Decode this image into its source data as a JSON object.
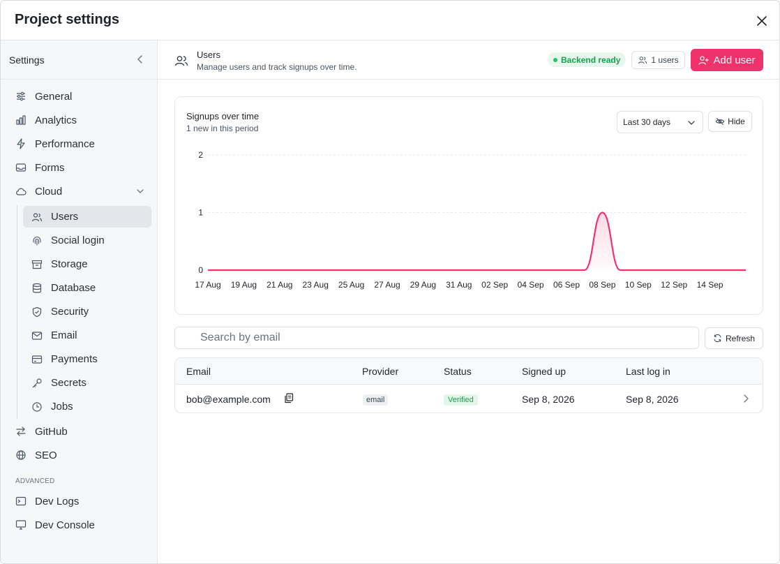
{
  "window": {
    "title": "Project settings"
  },
  "sidebar": {
    "header": "Settings",
    "items": [
      {
        "label": "General",
        "icon": "sliders-icon"
      },
      {
        "label": "Analytics",
        "icon": "bar-chart-icon"
      },
      {
        "label": "Performance",
        "icon": "lightning-icon"
      },
      {
        "label": "Forms",
        "icon": "inbox-icon"
      },
      {
        "label": "Cloud",
        "icon": "cloud-icon"
      }
    ],
    "cloud_items": [
      {
        "label": "Users",
        "icon": "users-icon"
      },
      {
        "label": "Social login",
        "icon": "fingerprint-icon"
      },
      {
        "label": "Storage",
        "icon": "archive-icon"
      },
      {
        "label": "Database",
        "icon": "database-icon"
      },
      {
        "label": "Security",
        "icon": "shield-icon"
      },
      {
        "label": "Email",
        "icon": "mail-icon"
      },
      {
        "label": "Payments",
        "icon": "credit-card-icon"
      },
      {
        "label": "Secrets",
        "icon": "key-icon"
      },
      {
        "label": "Jobs",
        "icon": "clock-icon"
      }
    ],
    "more_items": [
      {
        "label": "GitHub",
        "icon": "git-icon"
      },
      {
        "label": "SEO",
        "icon": "globe-icon"
      }
    ],
    "advanced_label": "ADVANCED",
    "advanced_items": [
      {
        "label": "Dev Logs",
        "icon": "terminal-icon"
      },
      {
        "label": "Dev Console",
        "icon": "monitor-icon"
      }
    ]
  },
  "header": {
    "title": "Users",
    "subtitle": "Manage users and track signups over time.",
    "status": "Backend ready",
    "users_count": "1 users",
    "add_user": "Add user"
  },
  "chart_card": {
    "title": "Signups over time",
    "subtitle": "1 new in this period",
    "range": "Last 30 days",
    "hide_label": "Hide"
  },
  "chart_data": {
    "type": "area",
    "x": [
      "17 Aug",
      "18 Aug",
      "19 Aug",
      "20 Aug",
      "21 Aug",
      "22 Aug",
      "23 Aug",
      "24 Aug",
      "25 Aug",
      "26 Aug",
      "27 Aug",
      "28 Aug",
      "29 Aug",
      "30 Aug",
      "31 Aug",
      "01 Sep",
      "02 Sep",
      "03 Sep",
      "04 Sep",
      "05 Sep",
      "06 Sep",
      "07 Sep",
      "08 Sep",
      "09 Sep",
      "10 Sep",
      "11 Sep",
      "12 Sep",
      "13 Sep",
      "14 Sep",
      "15 Sep",
      "16 Sep"
    ],
    "tick_labels": [
      "17 Aug",
      "19 Aug",
      "21 Aug",
      "23 Aug",
      "25 Aug",
      "27 Aug",
      "29 Aug",
      "31 Aug",
      "02 Sep",
      "04 Sep",
      "06 Sep",
      "08 Sep",
      "10 Sep",
      "12 Sep",
      "14 Sep"
    ],
    "series": [
      {
        "values": [
          0,
          0,
          0,
          0,
          0,
          0,
          0,
          0,
          0,
          0,
          0,
          0,
          0,
          0,
          0,
          0,
          0,
          0,
          0,
          0,
          0,
          0,
          1,
          0,
          0,
          0,
          0,
          0,
          0,
          0,
          0
        ]
      }
    ],
    "y_ticks": [
      0,
      1,
      2
    ],
    "ylim": [
      0,
      2
    ],
    "grid": true,
    "color": "#f0326c"
  },
  "search": {
    "placeholder": "Search by email",
    "value": ""
  },
  "refresh_label": "Refresh",
  "table": {
    "columns": [
      "Email",
      "Provider",
      "Status",
      "Signed up",
      "Last log in"
    ],
    "rows": [
      {
        "email": "bob@example.com",
        "provider": "email",
        "status": "Verified",
        "signed_up": "Sep 8, 2026",
        "last_login": "Sep 8, 2026"
      }
    ]
  }
}
